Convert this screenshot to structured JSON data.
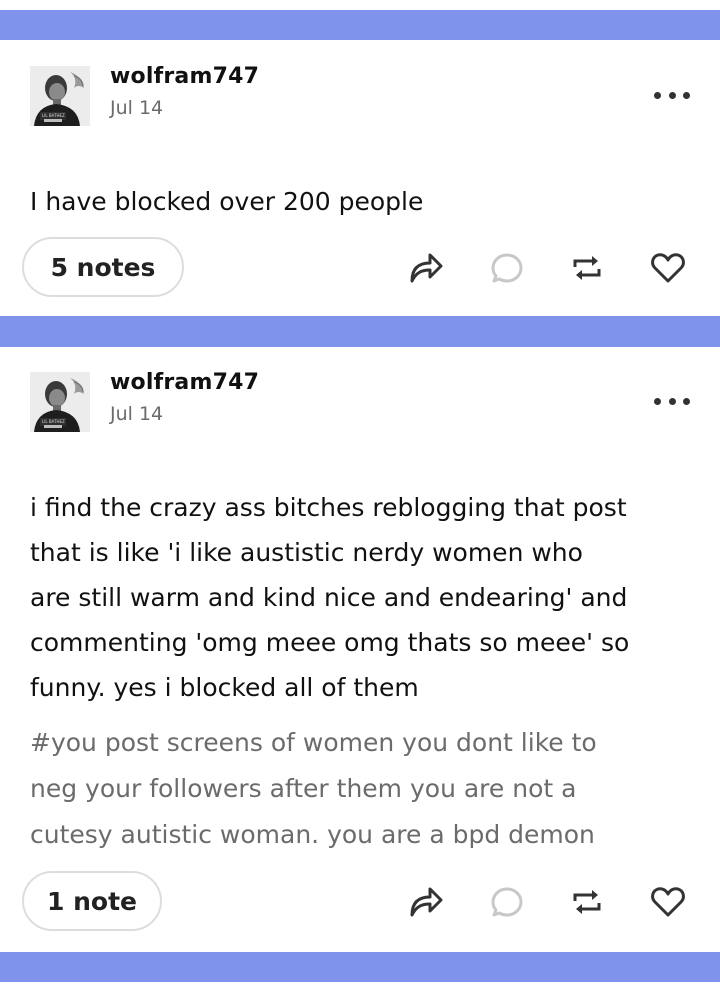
{
  "posts": [
    {
      "username": "wolfram747",
      "date": "Jul 14",
      "avatar_icon": "profile-photo",
      "more_icon": "more-options-icon",
      "text": "I have blocked over 200 people",
      "tags": "",
      "notes_label": "5 notes",
      "actions": [
        "share-icon",
        "reply-icon",
        "reblog-icon",
        "like-icon"
      ]
    },
    {
      "username": "wolfram747",
      "date": "Jul 14",
      "avatar_icon": "profile-photo",
      "more_icon": "more-options-icon",
      "text_lines": [
        "i find the crazy ass bitches reblogging that post",
        "that is like 'i like austistic nerdy women who",
        "are still warm and kind nice and endearing' and",
        "commenting 'omg meee omg thats so meee' so",
        "funny. yes i blocked all of them"
      ],
      "tag_lines": [
        "#you post screens of women you dont like to",
        "neg your followers after them you are not a",
        "cutesy autistic woman. you are a bpd demon"
      ],
      "notes_label": "1 note",
      "actions": [
        "share-icon",
        "reply-icon",
        "reblog-icon",
        "like-icon"
      ]
    }
  ],
  "colors": {
    "divider": "#8093ec",
    "text": "#111111",
    "muted": "#6b6b6b",
    "reply_icon": "#c8c8c8"
  }
}
